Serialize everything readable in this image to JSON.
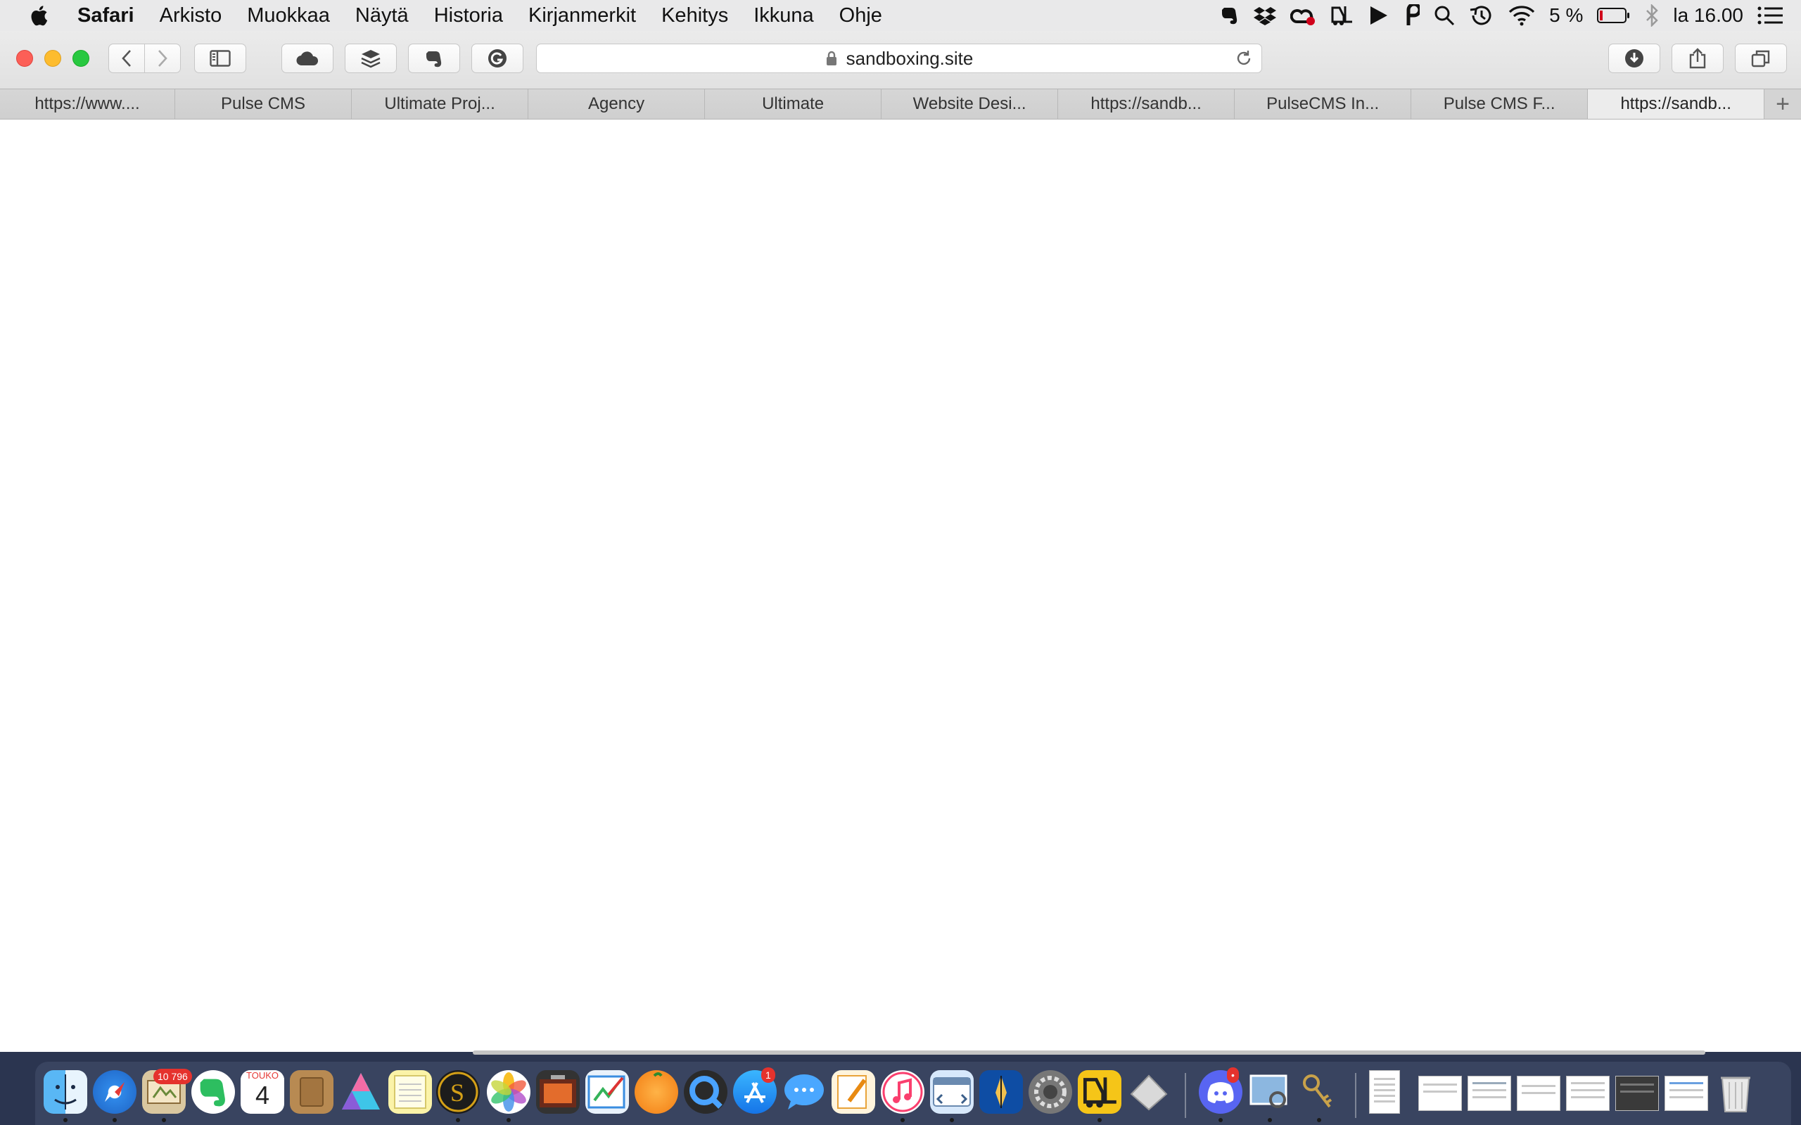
{
  "menubar": {
    "app_name": "Safari",
    "menus": [
      "Arkisto",
      "Muokkaa",
      "Näytä",
      "Historia",
      "Kirjanmerkit",
      "Kehitys",
      "Ikkuna",
      "Ohje"
    ],
    "status_icons": [
      "evernote-icon",
      "dropbox-icon",
      "creative-cloud-icon",
      "forklift-icon",
      "play-icon",
      "pocket-icon",
      "search-icon",
      "time-machine-icon",
      "wifi-icon"
    ],
    "battery_percent": "5 %",
    "bluetooth_icon": "bluetooth-icon",
    "clock": "la 16.00",
    "control_icon": "notification-list-icon"
  },
  "toolbar": {
    "url": "sandboxing.site",
    "buttons": [
      "back-icon",
      "forward-icon",
      "sidebar-icon",
      "cloud-icon",
      "layers-icon",
      "evernote-clipper-icon",
      "grammarly-icon",
      "downloads-icon",
      "share-icon",
      "tabs-overview-icon"
    ]
  },
  "tabs": [
    {
      "label": "https://www...."
    },
    {
      "label": "Pulse CMS"
    },
    {
      "label": "Ultimate Proj..."
    },
    {
      "label": "Agency"
    },
    {
      "label": "Ultimate"
    },
    {
      "label": "Website Desi..."
    },
    {
      "label": "https://sandb..."
    },
    {
      "label": "PulseCMS In..."
    },
    {
      "label": "Pulse CMS F..."
    },
    {
      "label": "https://sandb..."
    }
  ],
  "new_tab_label": "+",
  "active_tab_index": 9,
  "dock": {
    "apps": [
      "finder",
      "safari",
      "mail",
      "evernote",
      "calendar",
      "notefile",
      "affinity-designer",
      "notes",
      "scrivener",
      "photos",
      "photo-booth",
      "sketchbook",
      "squash",
      "quicktime",
      "app-store",
      "messages",
      "pages",
      "music",
      "coda",
      "vectornator",
      "system-preferences",
      "forklift",
      "preview-alt",
      "discord",
      "preview",
      "keychain",
      "document",
      "window-1",
      "window-2",
      "window-3",
      "window-4",
      "window-5",
      "window-6",
      "trash"
    ],
    "mail_badge": "10 796",
    "calendar_month": "TOUKO",
    "calendar_day": "4",
    "appstore_badge": "1",
    "discord_badge": "•"
  },
  "colors": {
    "menubar_bg": "#e9e9ea",
    "toolbar_bg": "#e1e1e1",
    "tab_active_bg": "#ececec",
    "content_bg": "#ffffff",
    "dock_bg": "#46506e"
  }
}
